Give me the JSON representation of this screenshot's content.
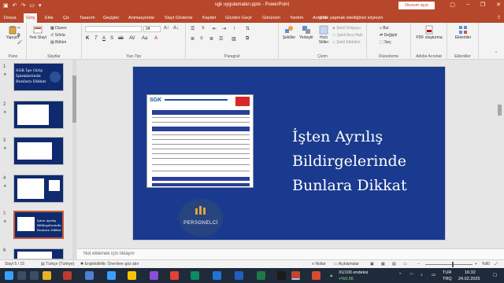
{
  "titlebar": {
    "title": "sgk uygulamaları.pptx  -  PowerPoint",
    "signin": "Oturum açın",
    "qat_icons": [
      "save-icon",
      "undo-icon",
      "redo-icon",
      "present-icon",
      "customize-icon"
    ],
    "window_controls": [
      "ribbon-display-icon",
      "minimize-icon",
      "restore-icon",
      "close-icon"
    ]
  },
  "tabs": [
    "Dosya",
    "Giriş",
    "Ekle",
    "Çiz",
    "Tasarım",
    "Geçişler",
    "Animasyonlar",
    "Slayt Gösterisi",
    "Kaydet",
    "Gözden Geçir",
    "Görünüm",
    "Yardım",
    "Acrobat"
  ],
  "active_tab": "Giriş",
  "tellme": "Ne yapmak istediğinizi söyleyin",
  "ribbon": {
    "pano": {
      "label": "Pano",
      "paste": "Yapıştır"
    },
    "slaytlar": {
      "label": "Slaytlar",
      "new_slide": "Yeni Slayt",
      "layout": "Düzen",
      "reset": "Sıfırla",
      "section": "Bölüm"
    },
    "yazi_tipi": {
      "label": "Yazı Tipi",
      "font_size": "24",
      "buttons": [
        "K",
        "T",
        "A",
        "S",
        "ab",
        "AV",
        "Aa",
        "A"
      ]
    },
    "paragraf": {
      "label": "Paragraf"
    },
    "cizim": {
      "label": "Çizim",
      "shapes": "Şekiller",
      "arrange": "Yerleştir",
      "quick_styles": "Hızlı Stiller",
      "fill": "Şekil Dolgusu",
      "outline": "Şekil Ana Hattı",
      "effects": "Şekil Efektleri"
    },
    "duzenleme": {
      "label": "Düzenleme",
      "find": "Bul",
      "replace": "Değiştir",
      "select": "Seç"
    },
    "acrobat": {
      "label": "Adobe Acrobat",
      "pdf": "PDF oluşturma"
    },
    "eklentiler": {
      "label": "Eklentiler",
      "addins": "Eklentiler"
    }
  },
  "thumbnails": [
    {
      "num": "1",
      "star": "★",
      "text": "SGK İşe Giriş İşlemlerinde Bunlara Dikkat"
    },
    {
      "num": "2",
      "star": "★",
      "text": ""
    },
    {
      "num": "3",
      "star": "★",
      "text": ""
    },
    {
      "num": "4",
      "star": "★",
      "text": ""
    },
    {
      "num": "5",
      "star": "★",
      "text": "İşten Ayrılış Bildirgelerinde Bunlara Dikkat"
    },
    {
      "num": "6",
      "star": "",
      "text": ""
    }
  ],
  "selected_slide": 5,
  "slide": {
    "title_lines": [
      "İşten Ayrılış",
      "Bildirgelerinde",
      "Bunlara Dikkat"
    ],
    "logo_text": "PERSONELCİ",
    "doc_header": "SGK"
  },
  "notes_placeholder": "Not eklemek için tıklayın",
  "statusbar": {
    "slide_count": "Slayt 5 / 15",
    "language": "Türkçe (Türkiye)",
    "accessibility": "Erişilebilirlik: Önerilere göz atın",
    "notes": "Notlar",
    "comments": "Açıklamalar",
    "zoom": "%80"
  },
  "taskbar": {
    "ticker_name": "XU100 endeksi",
    "ticker_change": "+%0,66",
    "lang": "TUR",
    "lang2": "TRQ",
    "time": "16:32",
    "date": "24.02.2025"
  }
}
